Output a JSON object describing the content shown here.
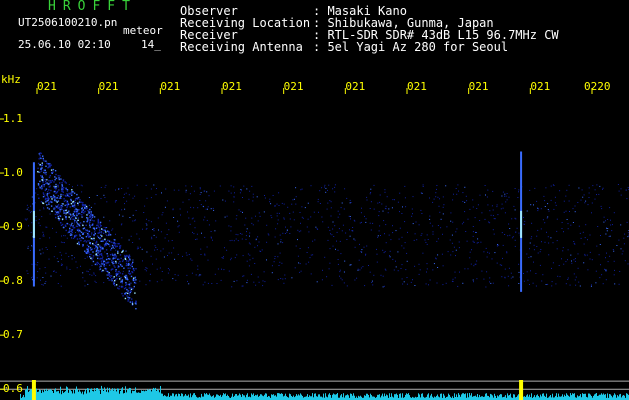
{
  "header": {
    "brand": "HROFFT",
    "file_name": "UT2506100210.pn",
    "meteor_label": "meteor",
    "date_time": "25.06.10 02:10",
    "counter": "14_"
  },
  "station": [
    {
      "key": "Observer",
      "value": ": Masaki Kano"
    },
    {
      "key": "Receiving Location",
      "value": ": Shibukawa, Gunma, Japan"
    },
    {
      "key": "Receiver",
      "value": ": RTL-SDR SDR# 43dB L15 96.7MHz CW"
    },
    {
      "key": "Receiving Antenna",
      "value": ": 5el Yagi Az 280 for Seoul"
    }
  ],
  "colors": {
    "text_green": "#39d23a",
    "text_white": "#ffffff",
    "axis_yellow": "#ffff00",
    "signal_low": "#1020a0",
    "signal_mid": "#3a6cff",
    "signal_high": "#9fe8ff",
    "noise_cyan": "#1ec8e6",
    "peak_yellow": "#ffff00",
    "threshold_line": "#b0b0b0"
  },
  "chart_data": {
    "type": "heatmap",
    "ylabel": "kHz",
    "y_ticks": [
      "1.1",
      "1.0",
      "0.9",
      "0.8",
      "0.7",
      "0.6"
    ],
    "y_tick_values": [
      1.1,
      1.0,
      0.9,
      0.8,
      0.7,
      0.6
    ],
    "ylim": [
      0.58,
      1.15
    ],
    "x_ticks": [
      "021",
      "021",
      "021",
      "021",
      "021",
      "021",
      "021",
      "021",
      "021",
      "0220"
    ],
    "x_tick_values": [
      0,
      1,
      2,
      3,
      4,
      5,
      6,
      7,
      8,
      9
    ],
    "x_unit": "minute index (02:10–02:20 UT)",
    "xlim": [
      -0.6,
      9.6
    ],
    "events": [
      {
        "kind": "head_echo",
        "time": -0.05,
        "f_min": 0.79,
        "f_max": 1.02
      },
      {
        "kind": "diffuse_trail",
        "time_start": 0.0,
        "time_end": 1.6,
        "f_start": 1.0,
        "f_end": 0.79
      },
      {
        "kind": "head_echo",
        "time": 7.85,
        "f_min": 0.78,
        "f_max": 1.04
      }
    ],
    "background_band": {
      "time_start": -0.2,
      "time_end": 9.6,
      "f_min": 0.79,
      "f_max": 0.98
    },
    "threshold_lines": [
      0.615,
      0.6
    ],
    "grid": false
  }
}
